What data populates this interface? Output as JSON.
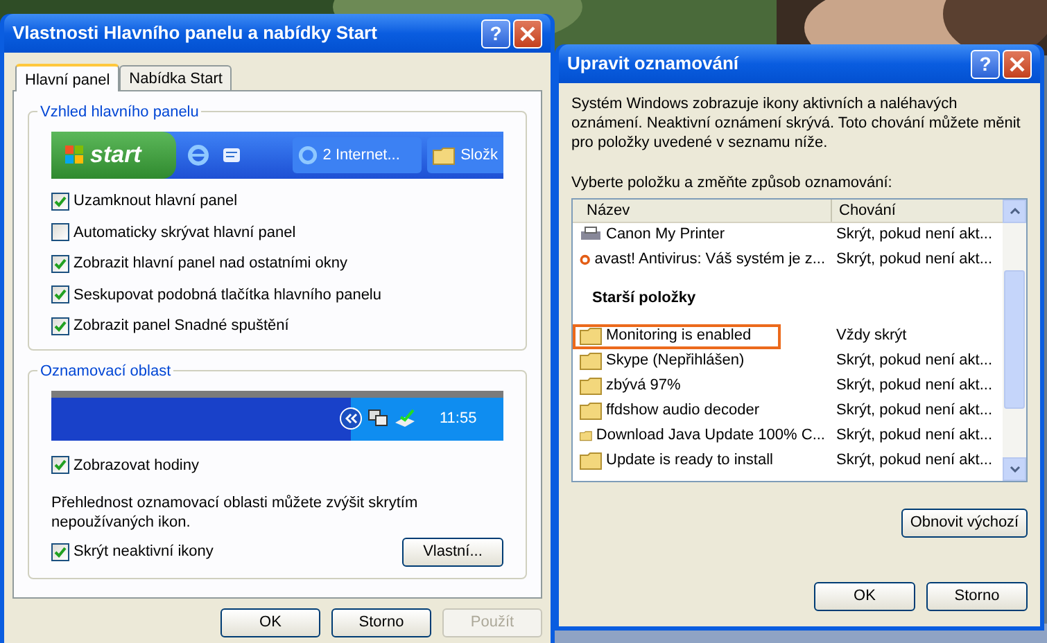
{
  "left_window": {
    "title": "Vlastnosti Hlavního panelu a nabídky Start",
    "help_label": "?",
    "tabs": [
      {
        "label": "Hlavní panel",
        "selected": true
      },
      {
        "label": "Nabídka Start",
        "selected": false
      }
    ],
    "taskbar_group": {
      "title": "Vzhled hlavního panelu",
      "start_label": "start",
      "task_button": "2 Internet...",
      "folder_button": "Složk"
    },
    "options": [
      {
        "label": "Uzamknout hlavní panel",
        "checked": true
      },
      {
        "label": "Automaticky skrývat hlavní panel",
        "checked": false
      },
      {
        "label": "Zobrazit hlavní panel nad ostatními okny",
        "checked": true
      },
      {
        "label": "Seskupovat podobná tlačítka hlavního panelu",
        "checked": true
      },
      {
        "label": "Zobrazit panel Snadné spuštění",
        "checked": true
      }
    ],
    "tray_group": {
      "title": "Oznamovací oblast",
      "clock": "11:55",
      "show_clock": {
        "label": "Zobrazovat hodiny",
        "checked": true
      },
      "description": "Přehlednost oznamovací oblasti můžete zvýšit skrytím nepoužívaných ikon.",
      "hide_inactive": {
        "label": "Skrýt neaktivní ikony",
        "checked": true
      },
      "customize_button": "Vlastní..."
    },
    "buttons": [
      {
        "label": "OK",
        "disabled": false
      },
      {
        "label": "Storno",
        "disabled": false
      },
      {
        "label": "Použít",
        "disabled": true
      }
    ]
  },
  "right_window": {
    "title": "Upravit oznamování",
    "help_label": "?",
    "description": "Systém Windows zobrazuje ikony aktivních a naléhavých oznámení. Neaktivní oznámení skrývá. Toto chování můžete měnit pro položky uvedené v seznamu níže.",
    "prompt": "Vyberte položku a změňte způsob oznamování:",
    "columns": [
      "Název",
      "Chování"
    ],
    "rows": [
      {
        "kind": "printer",
        "name": "Canon My Printer",
        "behavior": "Skrýt, pokud není akt...",
        "highlighted": false
      },
      {
        "kind": "logo",
        "name": "avast! Antivirus: Váš systém je z...",
        "behavior": "Skrýt, pokud není akt...",
        "highlighted": false
      },
      {
        "kind": "section",
        "name": "Starší položky"
      },
      {
        "kind": "folder",
        "name": "Monitoring is enabled",
        "behavior": "Vždy skrýt",
        "highlighted": true
      },
      {
        "kind": "folder",
        "name": "Skype (Nepřihlášen)",
        "behavior": "Skrýt, pokud není akt...",
        "highlighted": false
      },
      {
        "kind": "folder",
        "name": "zbývá 97%",
        "behavior": "Skrýt, pokud není akt...",
        "highlighted": false
      },
      {
        "kind": "folder",
        "name": "ffdshow audio decoder",
        "behavior": "Skrýt, pokud není akt...",
        "highlighted": false
      },
      {
        "kind": "folder",
        "name": "Download Java Update 100% C...",
        "behavior": "Skrýt, pokud není akt...",
        "highlighted": false
      },
      {
        "kind": "folder",
        "name": "Update is ready to install",
        "behavior": "Skrýt, pokud není akt...",
        "highlighted": false
      }
    ],
    "restore_button": "Obnovit výchozí",
    "buttons": [
      {
        "label": "OK",
        "disabled": false
      },
      {
        "label": "Storno",
        "disabled": false
      }
    ]
  }
}
